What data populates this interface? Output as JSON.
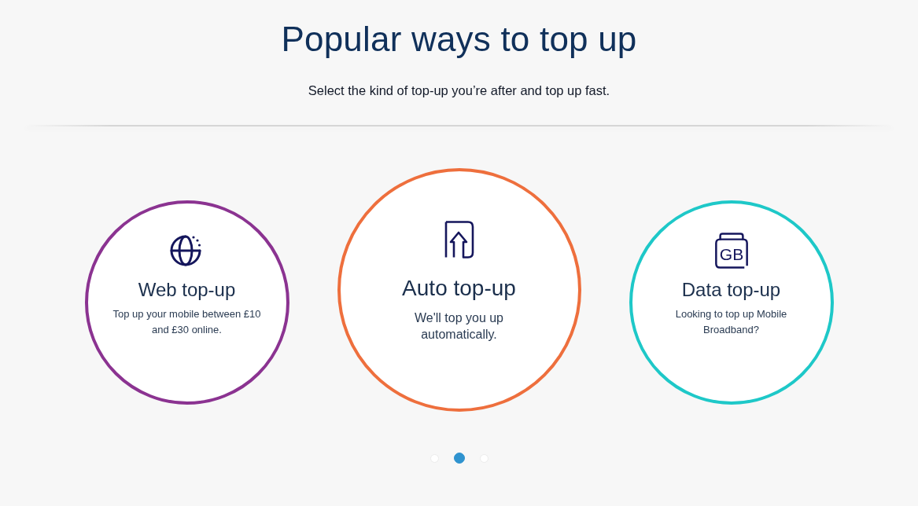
{
  "title": "Popular ways to top up",
  "subtitle": "Select the kind of top-up you’re after and top up fast.",
  "cards": [
    {
      "kind": "web",
      "title": "Web top-up",
      "description": "Top up your mobile between £10 and £30 online.",
      "color": "#8b3391",
      "selected": false
    },
    {
      "kind": "auto",
      "title": "Auto top-up",
      "description": "We'll top you up automatically.",
      "color": "#ee6f3d",
      "selected": true
    },
    {
      "kind": "data",
      "title": "Data top-up",
      "description": "Looking to top up Mobile Broadband?",
      "color": "#1ec8c8",
      "icon_text": "GB",
      "selected": false
    }
  ],
  "carousel_dots": [
    {
      "selected": false
    },
    {
      "selected": true
    },
    {
      "selected": false
    }
  ]
}
